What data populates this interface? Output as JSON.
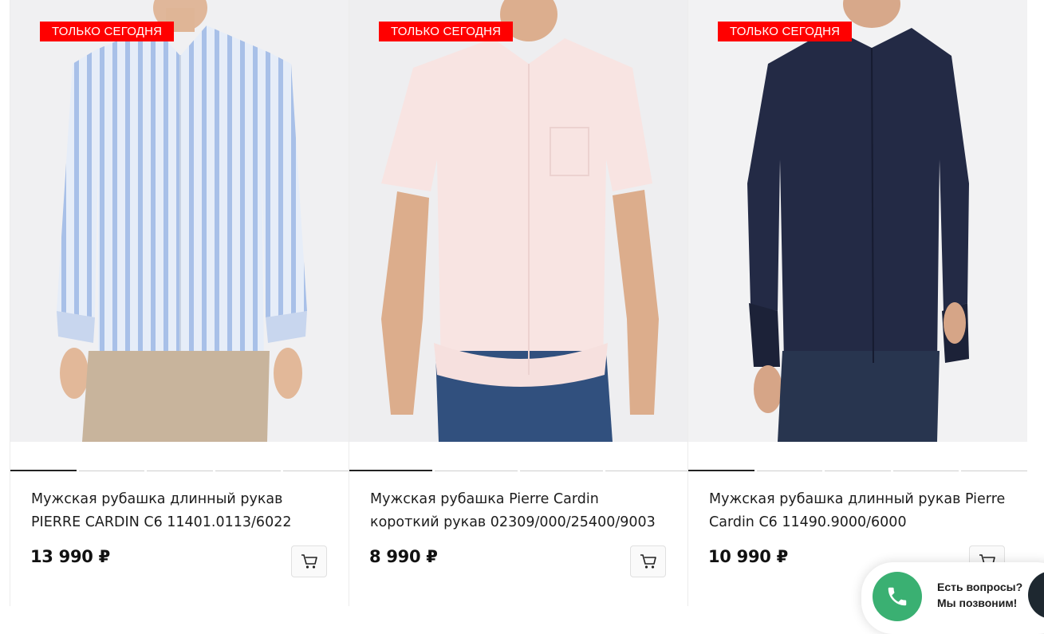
{
  "products": [
    {
      "badge": "ТОЛЬКО СЕГОДНЯ",
      "title": "Мужская рубашка длинный рукав  PIERRE CARDIN C6 11401.0113/6022",
      "price": "13 990 ₽",
      "image_icon": "striped-light-blue-shirt",
      "colors": {
        "bg": "#f0f0f2",
        "shirt": "#d6e2f4",
        "stripe": "#9db8e6",
        "pants": "#c6b29a"
      }
    },
    {
      "badge": "ТОЛЬКО СЕГОДНЯ",
      "title": "Мужская рубашка Pierre Cardin короткий рукав 02309/000/25400/9003",
      "price": "8 990 ₽",
      "image_icon": "pink-short-sleeve-shirt",
      "colors": {
        "bg": "#eeeef0",
        "shirt": "#f8e6e4",
        "stripe": "#f8e6e4",
        "pants": "#2f4f7e"
      }
    },
    {
      "badge": "ТОЛЬКО СЕГОДНЯ",
      "title": "Мужская рубашка длинный рукав Pierre Cardin C6 11490.9000/6000",
      "price": "10 990 ₽",
      "image_icon": "navy-long-sleeve-shirt",
      "colors": {
        "bg": "#f2f2f3",
        "shirt": "#232a45",
        "stripe": "#232a45",
        "pants": "#27334f"
      }
    }
  ],
  "callback": {
    "line1": "Есть вопросы?",
    "line2": "Мы позвоним!",
    "icon": "phone-icon",
    "color": "#3ab072"
  },
  "accent": {
    "badge": "#ff0000"
  }
}
